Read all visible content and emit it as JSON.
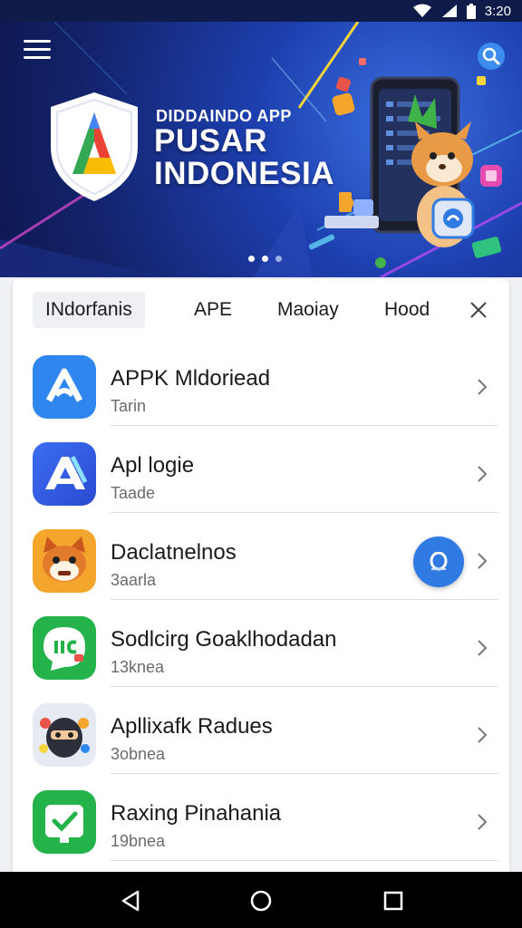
{
  "status_bar": {
    "time": "3:20",
    "icons": [
      "wifi-icon",
      "signal-icon",
      "battery-icon"
    ]
  },
  "hero": {
    "subtitle": "DIDDAINDO APP",
    "title_line1": "PUSAR",
    "title_line2": "INDONESIA",
    "slides": 3,
    "active_slide": 1
  },
  "tabs": [
    {
      "label": "INdorfanis",
      "active": true
    },
    {
      "label": "APE",
      "active": false
    },
    {
      "label": "Maoiay",
      "active": false
    },
    {
      "label": "Hood",
      "active": false
    }
  ],
  "apps": [
    {
      "title": "APPK Mldoriead",
      "subtitle": "Tarin",
      "icon": "app-a-blue-icon"
    },
    {
      "title": "Apl logie",
      "subtitle": "Taade",
      "icon": "app-a-indigo-icon"
    },
    {
      "title": "Daclatnelnos",
      "subtitle": "3aarla",
      "icon": "fox-mascot-icon"
    },
    {
      "title": "Sodlcirg Goaklhodadan",
      "subtitle": "13knea",
      "icon": "chat-green-icon"
    },
    {
      "title": "Apllixafk Radues",
      "subtitle": "3obnea",
      "icon": "ninja-mascot-icon"
    },
    {
      "title": "Raxing Pinahania",
      "subtitle": "19bnea",
      "icon": "check-green-icon"
    }
  ],
  "colors": {
    "primary_blue": "#2f7be3",
    "hero_dark": "#13236b",
    "green": "#23b34a",
    "orange": "#f4a52b"
  }
}
